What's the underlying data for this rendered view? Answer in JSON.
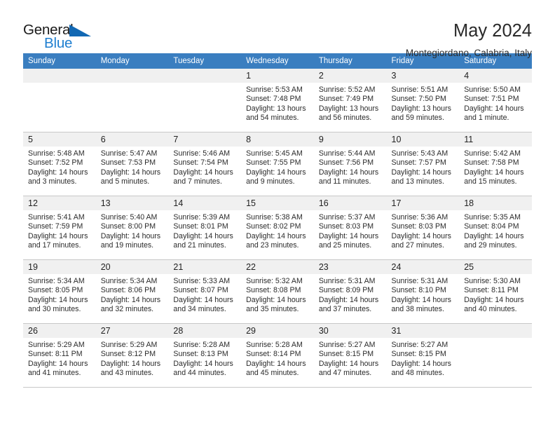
{
  "logo": {
    "word_one": "General",
    "word_two": "Blue",
    "triangle_color": "#1268b3",
    "blue_text_color": "#1f7fd0"
  },
  "header": {
    "title": "May 2024",
    "subtitle": "Montegiordano, Calabria, Italy",
    "header_bg_color": "#3a7ec0",
    "daynum_bg_color": "#f0f0f0"
  },
  "calendar": {
    "weekday_headers": [
      "Sunday",
      "Monday",
      "Tuesday",
      "Wednesday",
      "Thursday",
      "Friday",
      "Saturday"
    ],
    "labels": {
      "sunrise": "Sunrise:",
      "sunset": "Sunset:",
      "daylight": "Daylight:"
    },
    "weeks": [
      [
        {
          "day": "",
          "blank": true
        },
        {
          "day": "",
          "blank": true
        },
        {
          "day": "",
          "blank": true
        },
        {
          "day": "1",
          "sunrise": "Sunrise: 5:53 AM",
          "sunset": "Sunset: 7:48 PM",
          "daylight_line1": "Daylight: 13 hours",
          "daylight_line2": "and 54 minutes."
        },
        {
          "day": "2",
          "sunrise": "Sunrise: 5:52 AM",
          "sunset": "Sunset: 7:49 PM",
          "daylight_line1": "Daylight: 13 hours",
          "daylight_line2": "and 56 minutes."
        },
        {
          "day": "3",
          "sunrise": "Sunrise: 5:51 AM",
          "sunset": "Sunset: 7:50 PM",
          "daylight_line1": "Daylight: 13 hours",
          "daylight_line2": "and 59 minutes."
        },
        {
          "day": "4",
          "sunrise": "Sunrise: 5:50 AM",
          "sunset": "Sunset: 7:51 PM",
          "daylight_line1": "Daylight: 14 hours",
          "daylight_line2": "and 1 minute."
        }
      ],
      [
        {
          "day": "5",
          "sunrise": "Sunrise: 5:48 AM",
          "sunset": "Sunset: 7:52 PM",
          "daylight_line1": "Daylight: 14 hours",
          "daylight_line2": "and 3 minutes."
        },
        {
          "day": "6",
          "sunrise": "Sunrise: 5:47 AM",
          "sunset": "Sunset: 7:53 PM",
          "daylight_line1": "Daylight: 14 hours",
          "daylight_line2": "and 5 minutes."
        },
        {
          "day": "7",
          "sunrise": "Sunrise: 5:46 AM",
          "sunset": "Sunset: 7:54 PM",
          "daylight_line1": "Daylight: 14 hours",
          "daylight_line2": "and 7 minutes."
        },
        {
          "day": "8",
          "sunrise": "Sunrise: 5:45 AM",
          "sunset": "Sunset: 7:55 PM",
          "daylight_line1": "Daylight: 14 hours",
          "daylight_line2": "and 9 minutes."
        },
        {
          "day": "9",
          "sunrise": "Sunrise: 5:44 AM",
          "sunset": "Sunset: 7:56 PM",
          "daylight_line1": "Daylight: 14 hours",
          "daylight_line2": "and 11 minutes."
        },
        {
          "day": "10",
          "sunrise": "Sunrise: 5:43 AM",
          "sunset": "Sunset: 7:57 PM",
          "daylight_line1": "Daylight: 14 hours",
          "daylight_line2": "and 13 minutes."
        },
        {
          "day": "11",
          "sunrise": "Sunrise: 5:42 AM",
          "sunset": "Sunset: 7:58 PM",
          "daylight_line1": "Daylight: 14 hours",
          "daylight_line2": "and 15 minutes."
        }
      ],
      [
        {
          "day": "12",
          "sunrise": "Sunrise: 5:41 AM",
          "sunset": "Sunset: 7:59 PM",
          "daylight_line1": "Daylight: 14 hours",
          "daylight_line2": "and 17 minutes."
        },
        {
          "day": "13",
          "sunrise": "Sunrise: 5:40 AM",
          "sunset": "Sunset: 8:00 PM",
          "daylight_line1": "Daylight: 14 hours",
          "daylight_line2": "and 19 minutes."
        },
        {
          "day": "14",
          "sunrise": "Sunrise: 5:39 AM",
          "sunset": "Sunset: 8:01 PM",
          "daylight_line1": "Daylight: 14 hours",
          "daylight_line2": "and 21 minutes."
        },
        {
          "day": "15",
          "sunrise": "Sunrise: 5:38 AM",
          "sunset": "Sunset: 8:02 PM",
          "daylight_line1": "Daylight: 14 hours",
          "daylight_line2": "and 23 minutes."
        },
        {
          "day": "16",
          "sunrise": "Sunrise: 5:37 AM",
          "sunset": "Sunset: 8:03 PM",
          "daylight_line1": "Daylight: 14 hours",
          "daylight_line2": "and 25 minutes."
        },
        {
          "day": "17",
          "sunrise": "Sunrise: 5:36 AM",
          "sunset": "Sunset: 8:03 PM",
          "daylight_line1": "Daylight: 14 hours",
          "daylight_line2": "and 27 minutes."
        },
        {
          "day": "18",
          "sunrise": "Sunrise: 5:35 AM",
          "sunset": "Sunset: 8:04 PM",
          "daylight_line1": "Daylight: 14 hours",
          "daylight_line2": "and 29 minutes."
        }
      ],
      [
        {
          "day": "19",
          "sunrise": "Sunrise: 5:34 AM",
          "sunset": "Sunset: 8:05 PM",
          "daylight_line1": "Daylight: 14 hours",
          "daylight_line2": "and 30 minutes."
        },
        {
          "day": "20",
          "sunrise": "Sunrise: 5:34 AM",
          "sunset": "Sunset: 8:06 PM",
          "daylight_line1": "Daylight: 14 hours",
          "daylight_line2": "and 32 minutes."
        },
        {
          "day": "21",
          "sunrise": "Sunrise: 5:33 AM",
          "sunset": "Sunset: 8:07 PM",
          "daylight_line1": "Daylight: 14 hours",
          "daylight_line2": "and 34 minutes."
        },
        {
          "day": "22",
          "sunrise": "Sunrise: 5:32 AM",
          "sunset": "Sunset: 8:08 PM",
          "daylight_line1": "Daylight: 14 hours",
          "daylight_line2": "and 35 minutes."
        },
        {
          "day": "23",
          "sunrise": "Sunrise: 5:31 AM",
          "sunset": "Sunset: 8:09 PM",
          "daylight_line1": "Daylight: 14 hours",
          "daylight_line2": "and 37 minutes."
        },
        {
          "day": "24",
          "sunrise": "Sunrise: 5:31 AM",
          "sunset": "Sunset: 8:10 PM",
          "daylight_line1": "Daylight: 14 hours",
          "daylight_line2": "and 38 minutes."
        },
        {
          "day": "25",
          "sunrise": "Sunrise: 5:30 AM",
          "sunset": "Sunset: 8:11 PM",
          "daylight_line1": "Daylight: 14 hours",
          "daylight_line2": "and 40 minutes."
        }
      ],
      [
        {
          "day": "26",
          "sunrise": "Sunrise: 5:29 AM",
          "sunset": "Sunset: 8:11 PM",
          "daylight_line1": "Daylight: 14 hours",
          "daylight_line2": "and 41 minutes."
        },
        {
          "day": "27",
          "sunrise": "Sunrise: 5:29 AM",
          "sunset": "Sunset: 8:12 PM",
          "daylight_line1": "Daylight: 14 hours",
          "daylight_line2": "and 43 minutes."
        },
        {
          "day": "28",
          "sunrise": "Sunrise: 5:28 AM",
          "sunset": "Sunset: 8:13 PM",
          "daylight_line1": "Daylight: 14 hours",
          "daylight_line2": "and 44 minutes."
        },
        {
          "day": "29",
          "sunrise": "Sunrise: 5:28 AM",
          "sunset": "Sunset: 8:14 PM",
          "daylight_line1": "Daylight: 14 hours",
          "daylight_line2": "and 45 minutes."
        },
        {
          "day": "30",
          "sunrise": "Sunrise: 5:27 AM",
          "sunset": "Sunset: 8:15 PM",
          "daylight_line1": "Daylight: 14 hours",
          "daylight_line2": "and 47 minutes."
        },
        {
          "day": "31",
          "sunrise": "Sunrise: 5:27 AM",
          "sunset": "Sunset: 8:15 PM",
          "daylight_line1": "Daylight: 14 hours",
          "daylight_line2": "and 48 minutes."
        },
        {
          "day": "",
          "blank": true
        }
      ]
    ]
  }
}
